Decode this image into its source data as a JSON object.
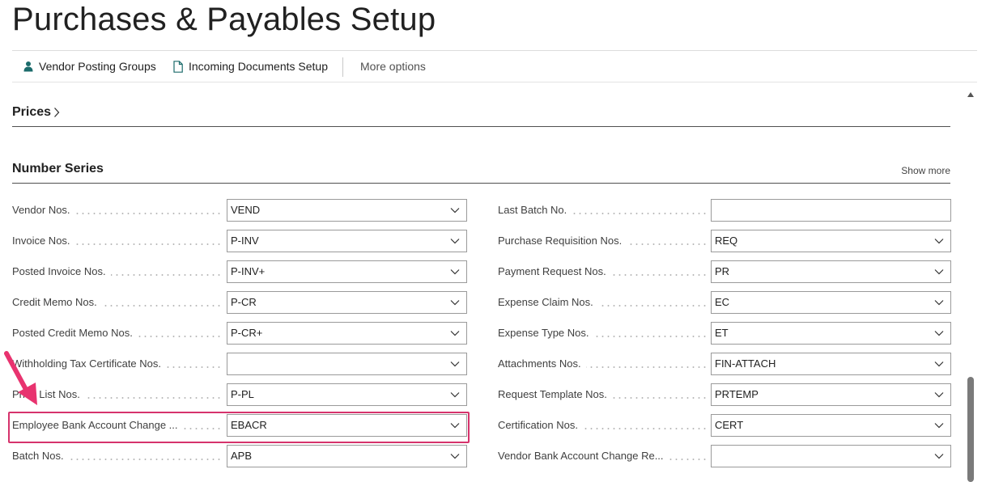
{
  "page": {
    "title": "Purchases & Payables Setup"
  },
  "actions": {
    "vendor_posting_groups": "Vendor Posting Groups",
    "incoming_documents_setup": "Incoming Documents Setup",
    "more_options": "More options"
  },
  "sections": {
    "prices": "Prices",
    "number_series": "Number Series",
    "show_more": "Show more"
  },
  "left_fields": [
    {
      "label": "Vendor Nos.",
      "value": "VEND"
    },
    {
      "label": "Invoice Nos.",
      "value": "P-INV"
    },
    {
      "label": "Posted Invoice Nos.",
      "value": "P-INV+"
    },
    {
      "label": "Credit Memo Nos.",
      "value": "P-CR"
    },
    {
      "label": "Posted Credit Memo Nos.",
      "value": "P-CR+"
    },
    {
      "label": "Withholding Tax Certificate Nos.",
      "value": ""
    },
    {
      "label": "Price List Nos.",
      "value": "P-PL"
    },
    {
      "label": "Employee Bank Account Change ...",
      "value": "EBACR"
    },
    {
      "label": "Batch Nos.",
      "value": "APB"
    }
  ],
  "right_fields": [
    {
      "label": "Last Batch No.",
      "value": ""
    },
    {
      "label": "Purchase Requisition Nos.",
      "value": "REQ"
    },
    {
      "label": "Payment Request Nos.",
      "value": "PR"
    },
    {
      "label": "Expense Claim Nos.",
      "value": "EC"
    },
    {
      "label": "Expense Type Nos.",
      "value": "ET"
    },
    {
      "label": "Attachments Nos.",
      "value": "FIN-ATTACH"
    },
    {
      "label": "Request Template Nos.",
      "value": "PRTEMP"
    },
    {
      "label": "Certification Nos.",
      "value": "CERT"
    },
    {
      "label": "Vendor Bank Account Change Re...",
      "value": ""
    }
  ],
  "icons": {
    "vendor": "person-icon",
    "documents": "document-icon",
    "dropdown": "chevron-down-icon",
    "prices": "chevron-right-icon"
  },
  "colors": {
    "highlight": "#d6336c",
    "accent": "#1b6b6b"
  }
}
